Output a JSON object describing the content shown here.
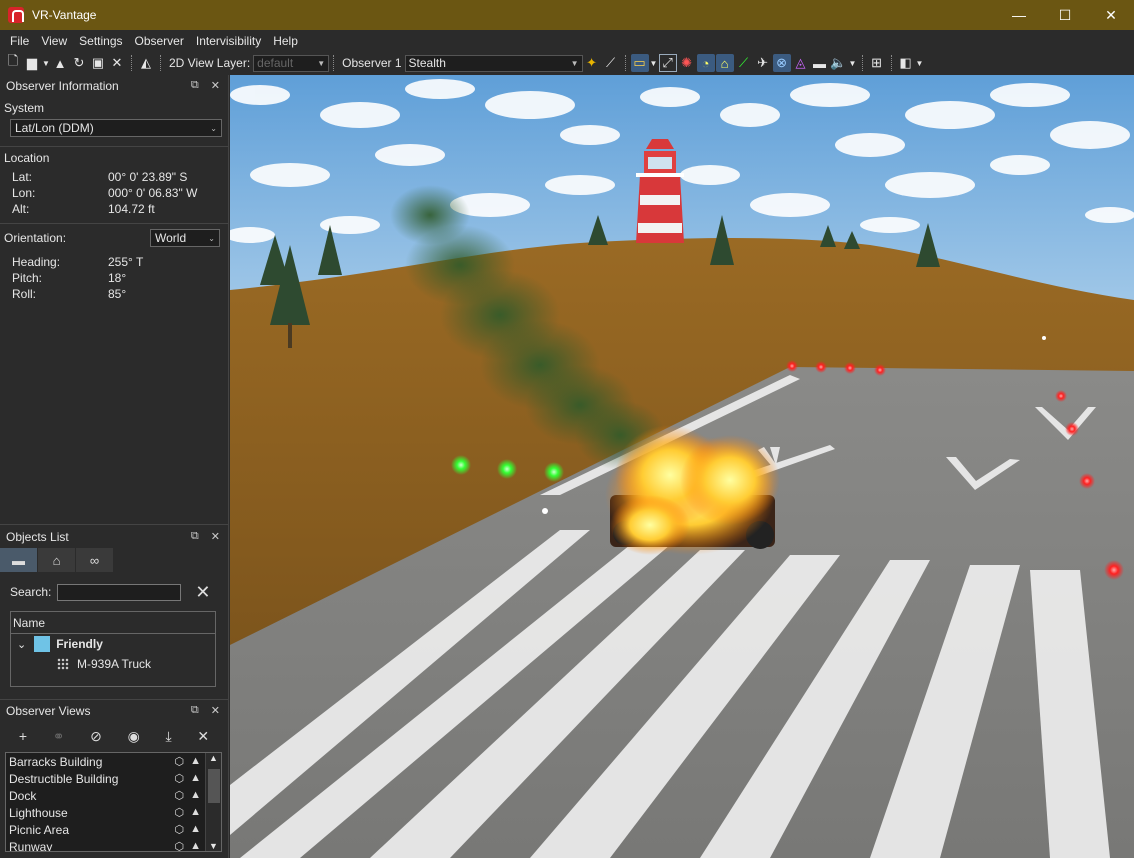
{
  "window": {
    "title": "VR-Vantage",
    "minimize": "—",
    "maximize": "☐",
    "close": "✕"
  },
  "menu": [
    "File",
    "View",
    "Settings",
    "Observer",
    "Intervisibility",
    "Help"
  ],
  "toolbar": {
    "view_layer_label": "2D View Layer:",
    "view_layer_value": "default",
    "observer_label": "Observer 1",
    "observer_mode": "Stealth"
  },
  "observer_info": {
    "title": "Observer Information",
    "system_label": "System",
    "system_value": "Lat/Lon (DDM)",
    "location_label": "Location",
    "lat_label": "Lat:",
    "lat_value": "00° 0' 23.89\" S",
    "lon_label": "Lon:",
    "lon_value": "000° 0' 06.83\" W",
    "alt_label": "Alt:",
    "alt_value": "104.72 ft",
    "orientation_label": "Orientation:",
    "orientation_value": "World",
    "heading_label": "Heading:",
    "heading_value": "255° T",
    "pitch_label": "Pitch:",
    "pitch_value": "18°",
    "roll_label": "Roll:",
    "roll_value": "85°"
  },
  "objects_list": {
    "title": "Objects List",
    "search_label": "Search:",
    "column_name": "Name",
    "group": "Friendly",
    "item": "M-939A Truck"
  },
  "observer_views": {
    "title": "Observer Views",
    "items": [
      "Barracks Building",
      "Destructible Building",
      "Dock",
      "Lighthouse",
      "Picnic Area",
      "Runway"
    ]
  },
  "icons": {
    "float": "⧉",
    "close": "✕",
    "add": "+",
    "clear": "✕"
  },
  "colors": {
    "titlebar": "#6b5612",
    "friendly": "#6fc3e6",
    "smoke": "#2f5a2a",
    "fire": "#ffcc33",
    "runway_light_red": "#ff2020",
    "marker_green": "#33ff33"
  }
}
